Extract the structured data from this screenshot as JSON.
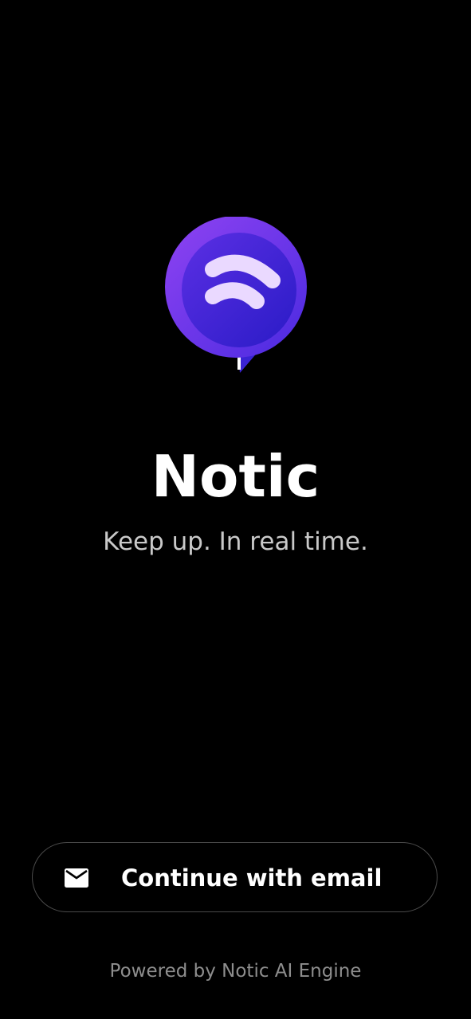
{
  "app": {
    "name": "Notic",
    "tagline": "Keep up. In real time."
  },
  "logo": {
    "icon": "chat-bubble-signal-logo",
    "colors": {
      "outer": "#7a3cf0",
      "inner": "#3b22d6",
      "waves": "#e9d8ff"
    }
  },
  "actions": {
    "continue_email": {
      "label": "Continue with email",
      "icon": "envelope-icon"
    }
  },
  "footer": {
    "text": "Powered by Notic AI Engine"
  },
  "theme": {
    "background": "#000000",
    "text_primary": "#ffffff",
    "text_secondary": "#c9c9c9",
    "text_muted": "#8e8e8e",
    "button_border": "#4a4a4a"
  }
}
